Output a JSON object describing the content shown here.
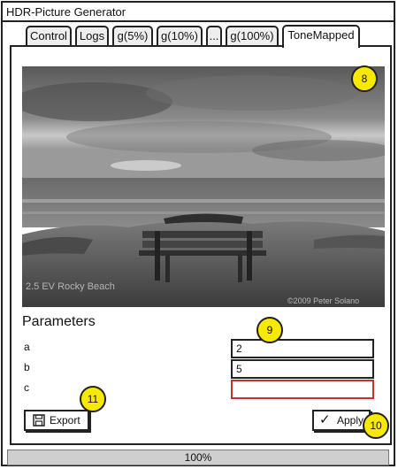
{
  "window": {
    "title": "HDR-Picture Generator"
  },
  "tabs": [
    {
      "label": "Control"
    },
    {
      "label": "Logs"
    },
    {
      "label": "g(5%)"
    },
    {
      "label": "g(10%)"
    },
    {
      "label": "..."
    },
    {
      "label": "g(100%)"
    },
    {
      "label": "ToneMapped",
      "active": true
    }
  ],
  "image": {
    "caption_left": "2.5 EV Rocky Beach",
    "caption_right": "©2009 Peter Solano"
  },
  "parameters": {
    "title": "Parameters",
    "fields": [
      {
        "label": "a",
        "value": "2"
      },
      {
        "label": "b",
        "value": "5"
      },
      {
        "label": "c",
        "value": "",
        "error": true
      }
    ]
  },
  "buttons": {
    "export_label": "Export",
    "apply_label": "Apply"
  },
  "markers": [
    "8",
    "9",
    "10",
    "11"
  ],
  "status": {
    "progress_text": "100%",
    "progress": 1.0
  },
  "colors": {
    "marker": "#f7ea00",
    "error_border": "#c8302e",
    "statusbar": "#cfcfcf"
  }
}
